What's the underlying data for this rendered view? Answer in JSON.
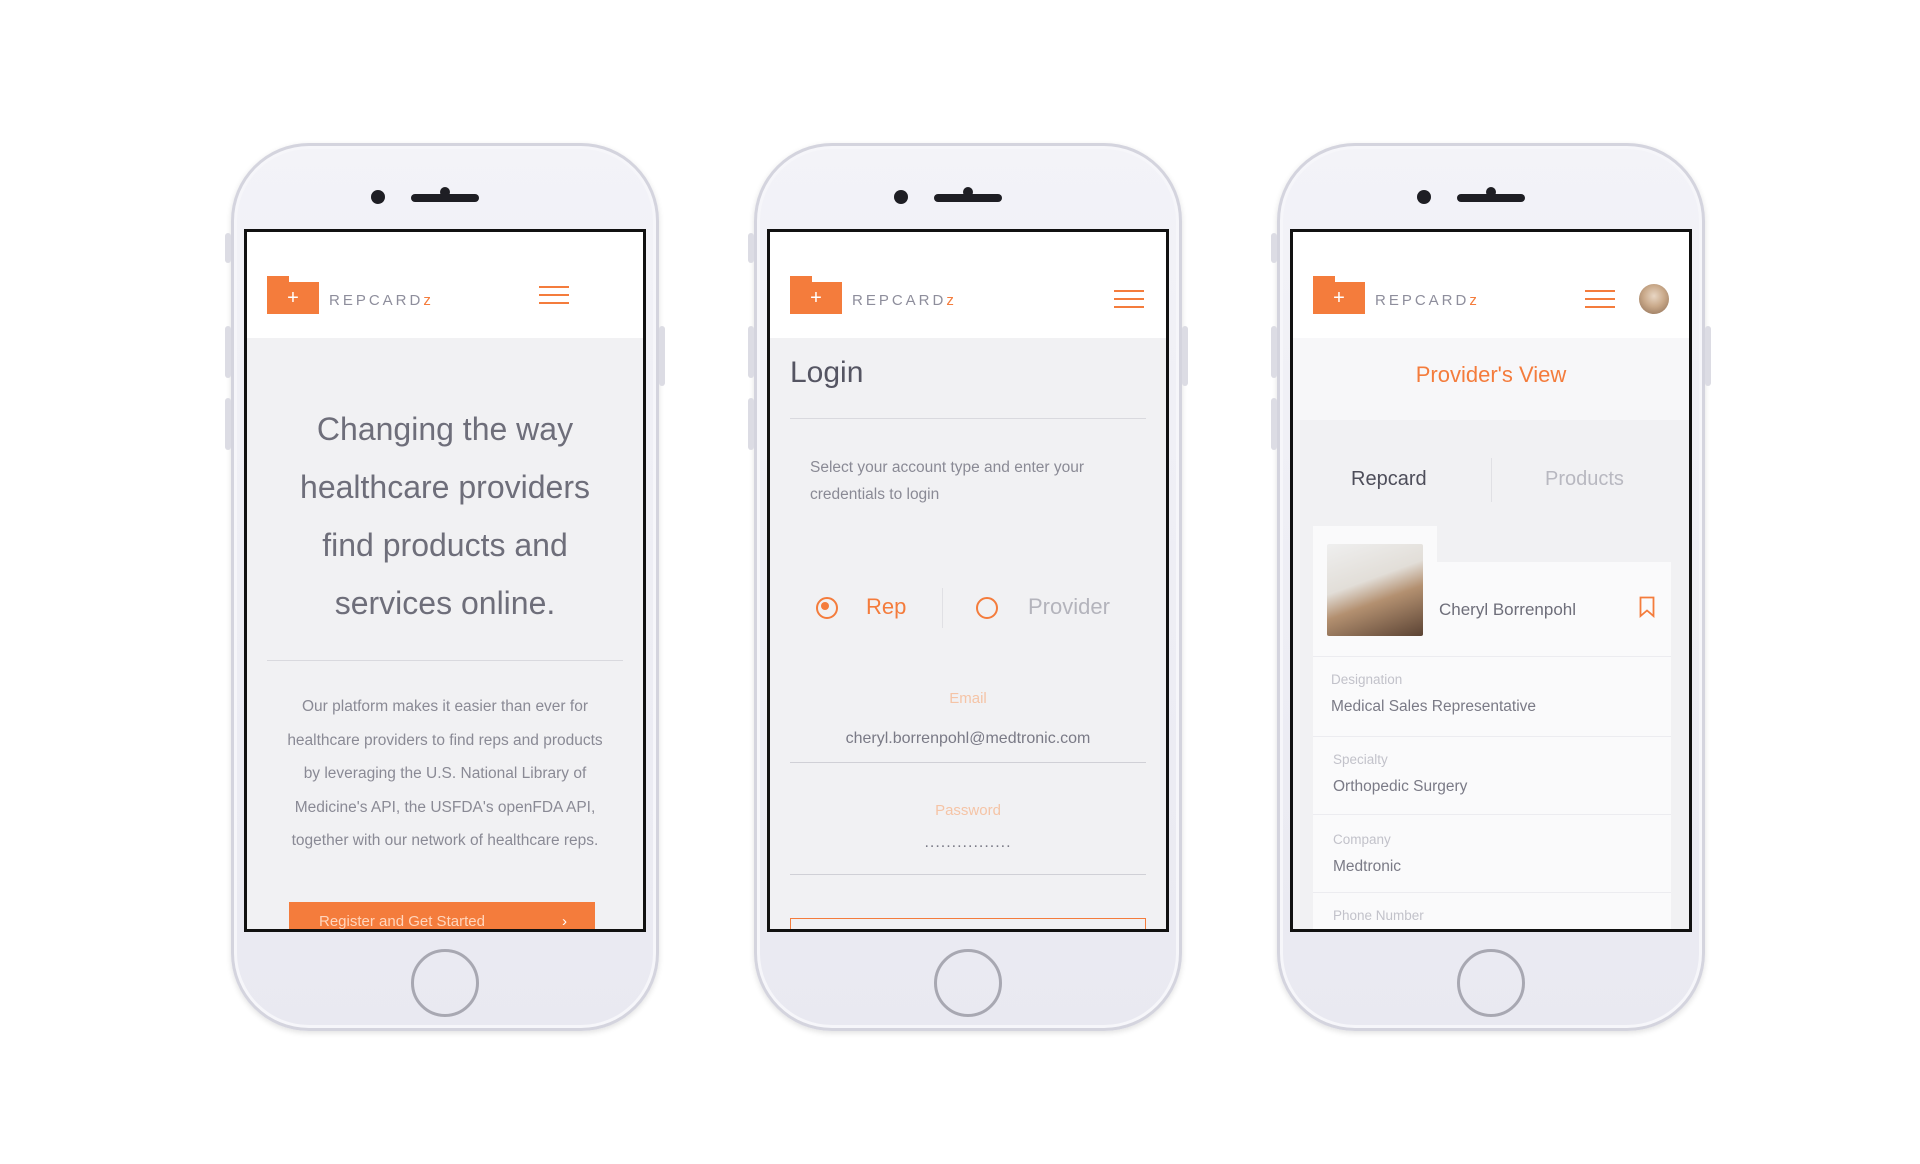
{
  "brand": {
    "name": "REPCARD",
    "suffix": "z",
    "logo_plus": "+"
  },
  "colors": {
    "accent": "#f47c3c",
    "text": "#6e6e7a",
    "background": "#f1f1f3"
  },
  "phone1": {
    "heading_lines": [
      "Changing the way",
      "healthcare providers",
      "find products and",
      "services online."
    ],
    "description_lines": [
      "Our platform makes it easier than ever for",
      "healthcare providers to find reps and products",
      "by leveraging the U.S. National Library of",
      "Medicine's API, the USFDA's openFDA API,",
      "together with our network of healthcare reps."
    ],
    "cta_label": "Register and Get Started",
    "cta_icon": "chevron-right-icon"
  },
  "phone2": {
    "title": "Login",
    "hint_lines": [
      "Select your account type and enter your",
      "credentials to login"
    ],
    "account_types": [
      {
        "label": "Rep",
        "selected": true
      },
      {
        "label": "Provider",
        "selected": false
      }
    ],
    "email": {
      "label": "Email",
      "value": "cheryl.borrenpohl@medtronic.com"
    },
    "password": {
      "label": "Password",
      "value": "................"
    }
  },
  "phone3": {
    "view_title": "Provider's View",
    "tabs": [
      {
        "label": "Repcard",
        "active": true
      },
      {
        "label": "Products",
        "active": false
      }
    ],
    "profile_name": "Cheryl Borrenpohl",
    "fields": [
      {
        "label": "Designation",
        "value": "Medical Sales Representative"
      },
      {
        "label": "Specialty",
        "value": "Orthopedic Surgery"
      },
      {
        "label": "Company",
        "value": "Medtronic"
      },
      {
        "label": "Phone Number",
        "value": ""
      }
    ]
  }
}
